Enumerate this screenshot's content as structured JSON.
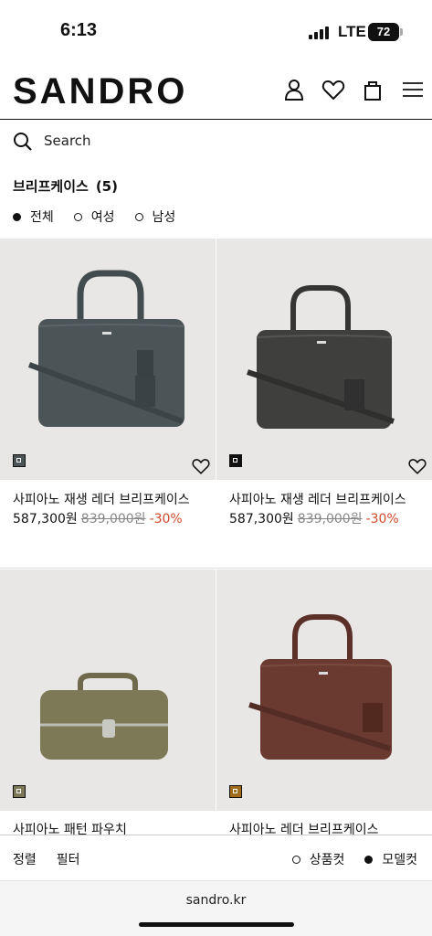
{
  "status": {
    "time": "6:13",
    "network": "LTE",
    "battery": "72"
  },
  "header": {
    "logo": "SANDRO",
    "icons": [
      "account-icon",
      "wishlist-heart-icon",
      "shopping-bag-icon",
      "menu-hamburger-icon"
    ]
  },
  "search": {
    "placeholder": "Search"
  },
  "category": {
    "title": "브리프케이스",
    "count": "(5)"
  },
  "filters": [
    {
      "label": "전체",
      "selected": true
    },
    {
      "label": "여성",
      "selected": false
    },
    {
      "label": "남성",
      "selected": false
    }
  ],
  "products": [
    {
      "name": "사피아노 재생 레더 브리프케이스",
      "price": "587,300원",
      "old_price": "839,000원",
      "discount": "-30%",
      "color": "#4b5558"
    },
    {
      "name": "사피아노 재생 레더 브리프케이스",
      "price": "587,300원",
      "old_price": "839,000원",
      "discount": "-30%",
      "color": "#3f3f3e"
    },
    {
      "name": "사피아노 패턴 파우치",
      "color": "#7d7856"
    },
    {
      "name": "사피아노 레더 브리프케이스",
      "color": "#6a3a31"
    }
  ],
  "bottom_bar": {
    "sort": "정렬",
    "filter": "필터",
    "view_product": "상품컷",
    "view_model": "모델컷"
  },
  "browser": {
    "url": "sandro.kr"
  }
}
